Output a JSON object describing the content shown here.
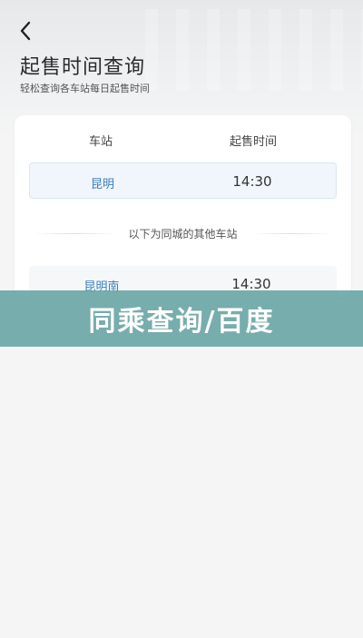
{
  "header": {
    "title": "起售时间查询",
    "subtitle": "轻松查询各车站每日起售时间"
  },
  "table": {
    "col_station": "车站",
    "col_time": "起售时间",
    "rows": [
      {
        "station": "昆明",
        "time": "14:30"
      }
    ],
    "divider_text": "以下为同城的其他车站",
    "other_rows": [
      {
        "station": "昆明南",
        "time": "14:30"
      }
    ]
  },
  "banner": {
    "text": "同乘查询/百度"
  },
  "colors": {
    "accent_link": "#3a7dbf",
    "banner_bg": "#62a1a0"
  }
}
